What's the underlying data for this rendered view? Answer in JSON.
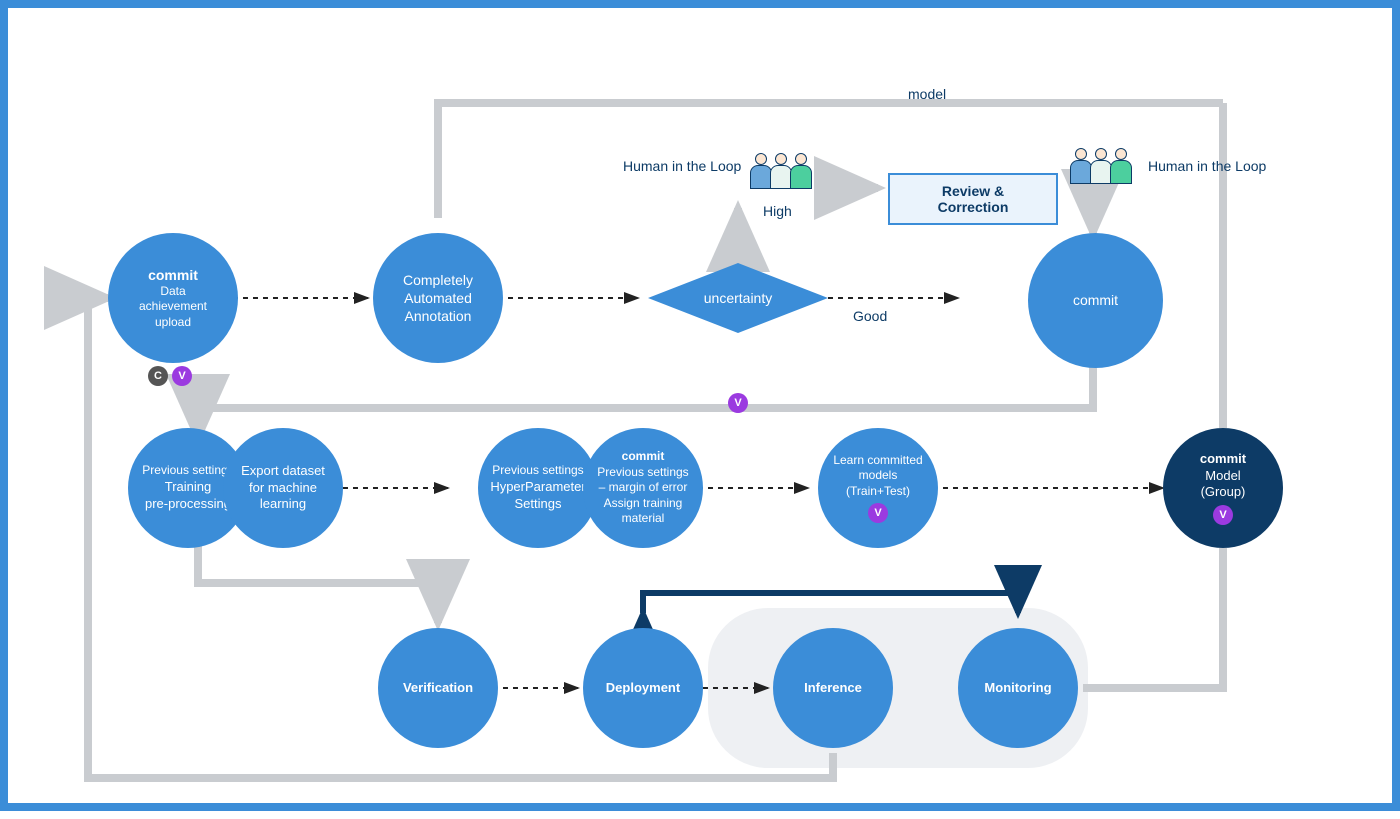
{
  "top_label_model": "model",
  "labels": {
    "hitl_left": "Human in the Loop",
    "hitl_right": "Human in the Loop",
    "high": "High",
    "good": "Good"
  },
  "review_box": "Review & Correction",
  "nodes": {
    "commit_upload": {
      "l1": "commit",
      "l2": "Data",
      "l3": "achievement",
      "l4": "upload"
    },
    "auto_annotation": {
      "l1": "Completely",
      "l2": "Automated",
      "l3": "Annotation"
    },
    "uncertainty": "uncertainty",
    "commit2": "commit",
    "training_prep": {
      "l1": "Previous settings",
      "l2": "Training",
      "l3": "pre-processing"
    },
    "export_dataset": {
      "l1": "Export dataset",
      "l2": "for machine",
      "l3": "learning"
    },
    "hyperparam": {
      "l1": "Previous settings",
      "l2": "HyperParameter",
      "l3": "Settings"
    },
    "margin_error": {
      "l1": "commit",
      "l2": "Previous settings",
      "l3": "– margin of error",
      "l4": "Assign training",
      "l5": "material"
    },
    "learn_models": {
      "l1": "Learn committed",
      "l2": "models",
      "l3": "(Train+Test)"
    },
    "commit_model": {
      "l1": "commit",
      "l2": "Model",
      "l3": "(Group)"
    },
    "verification": "Verification",
    "deployment": "Deployment",
    "inference": "Inference",
    "monitoring": "Monitoring"
  },
  "badges": {
    "c": "C",
    "v": "V"
  }
}
